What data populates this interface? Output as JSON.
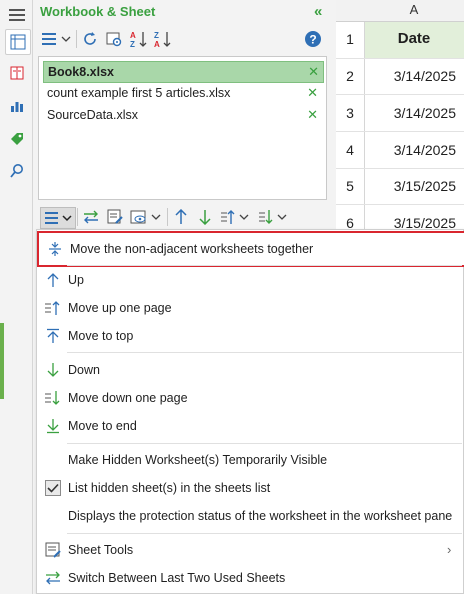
{
  "pane": {
    "title": "Workbook & Sheet",
    "collapse_glyph": "«"
  },
  "toolbar_icons": [
    "list-view-icon",
    "refresh-icon",
    "settings-icon",
    "sort-az-icon",
    "sort-za-icon",
    "help-icon"
  ],
  "workbooks": [
    {
      "name": "Book8.xlsx",
      "selected": true
    },
    {
      "name": "count example first 5 articles.xlsx",
      "selected": false
    },
    {
      "name": "SourceData.xlsx",
      "selected": false
    }
  ],
  "sheet": {
    "column_header": "A",
    "rows": [
      {
        "num": "1",
        "value": "Date"
      },
      {
        "num": "2",
        "value": "3/14/2025"
      },
      {
        "num": "3",
        "value": "3/14/2025"
      },
      {
        "num": "4",
        "value": "3/14/2025"
      },
      {
        "num": "5",
        "value": "3/15/2025"
      },
      {
        "num": "6",
        "value": "3/15/2025"
      }
    ]
  },
  "menu": {
    "items": [
      {
        "label": "Move the non-adjacent worksheets together",
        "icon": "collapse-arrows-icon"
      },
      {
        "label": "Up",
        "icon": "arrow-up-icon"
      },
      {
        "label": "Move up one page",
        "icon": "page-up-icon"
      },
      {
        "label": "Move to top",
        "icon": "move-top-icon"
      },
      {
        "label": "Down",
        "icon": "arrow-down-icon"
      },
      {
        "label": "Move down one page",
        "icon": "page-down-icon"
      },
      {
        "label": "Move to end",
        "icon": "move-end-icon"
      },
      {
        "label": "Make Hidden Worksheet(s) Temporarily Visible",
        "icon": ""
      },
      {
        "label": "List hidden sheet(s) in the sheets list",
        "icon": "checkbox-checked-icon",
        "checked": true
      },
      {
        "label": "Displays the protection status of the worksheet in the worksheet pane",
        "icon": ""
      },
      {
        "label": "Sheet Tools",
        "icon": "sheet-tools-icon"
      },
      {
        "label": "Switch Between Last Two Used Sheets",
        "icon": "switch-sheets-icon"
      }
    ]
  },
  "colors": {
    "accent": "#3aa040",
    "selected_row": "#a9d7a9",
    "highlight_border": "#d9262f",
    "header_green": "#e2efda"
  }
}
